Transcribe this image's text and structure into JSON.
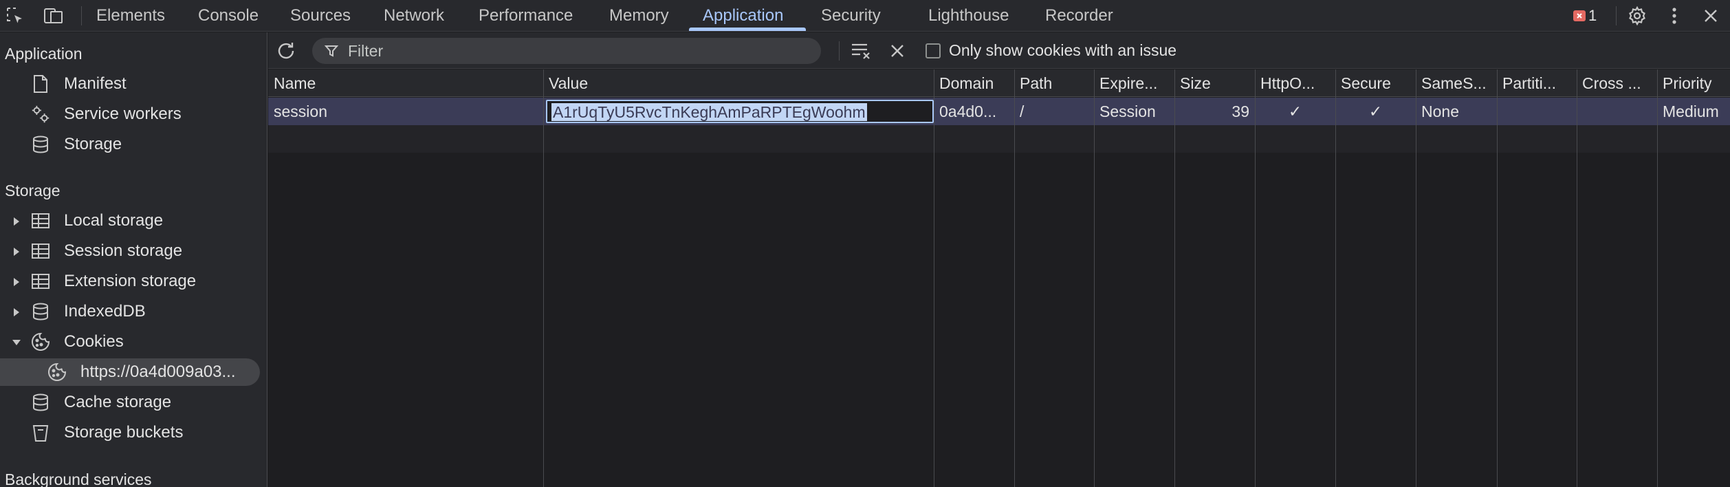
{
  "tabs": [
    {
      "label": "Elements"
    },
    {
      "label": "Console"
    },
    {
      "label": "Sources"
    },
    {
      "label": "Network"
    },
    {
      "label": "Performance"
    },
    {
      "label": "Memory"
    },
    {
      "label": "Application",
      "active": true
    },
    {
      "label": "Security"
    },
    {
      "label": "Lighthouse"
    },
    {
      "label": "Recorder"
    }
  ],
  "error_count": "1",
  "colors": {
    "accent": "#a8c7fa",
    "error": "#e46962",
    "selected_row": "#3b3c57"
  },
  "sidebar": {
    "application_heading": "Application",
    "application_items": [
      {
        "label": "Manifest",
        "icon": "document-icon"
      },
      {
        "label": "Service workers",
        "icon": "gears-icon"
      },
      {
        "label": "Storage",
        "icon": "database-icon"
      }
    ],
    "storage_heading": "Storage",
    "storage_items": [
      {
        "label": "Local storage",
        "icon": "table-icon",
        "expanded": false
      },
      {
        "label": "Session storage",
        "icon": "table-icon",
        "expanded": false
      },
      {
        "label": "Extension storage",
        "icon": "table-icon",
        "expanded": false
      },
      {
        "label": "IndexedDB",
        "icon": "database-icon",
        "expanded": false
      },
      {
        "label": "Cookies",
        "icon": "cookie-icon",
        "expanded": true
      }
    ],
    "cookie_child": {
      "label": "https://0a4d009a03...",
      "icon": "cookie-icon"
    },
    "storage_items_after": [
      {
        "label": "Cache storage",
        "icon": "database-icon"
      },
      {
        "label": "Storage buckets",
        "icon": "bucket-icon"
      }
    ],
    "background_heading": "Background services"
  },
  "toolbar": {
    "filter_placeholder": "Filter",
    "issue_checkbox_label": "Only show cookies with an issue",
    "issue_checked": false
  },
  "table": {
    "headers": [
      "Name",
      "Value",
      "Domain",
      "Path",
      "Expire...",
      "Size",
      "HttpO...",
      "Secure",
      "SameS...",
      "Partiti...",
      "Cross ...",
      "Priority"
    ],
    "rows": [
      {
        "name": "session",
        "value": "A1rUqTyU5RvcTnKeghAmPaRPTEgWoohm",
        "domain": "0a4d0...",
        "path": "/",
        "expires": "Session",
        "size": "39",
        "httponly": "✓",
        "secure": "✓",
        "samesite": "None",
        "partition": "",
        "cross_site": "",
        "priority": "Medium"
      }
    ]
  }
}
